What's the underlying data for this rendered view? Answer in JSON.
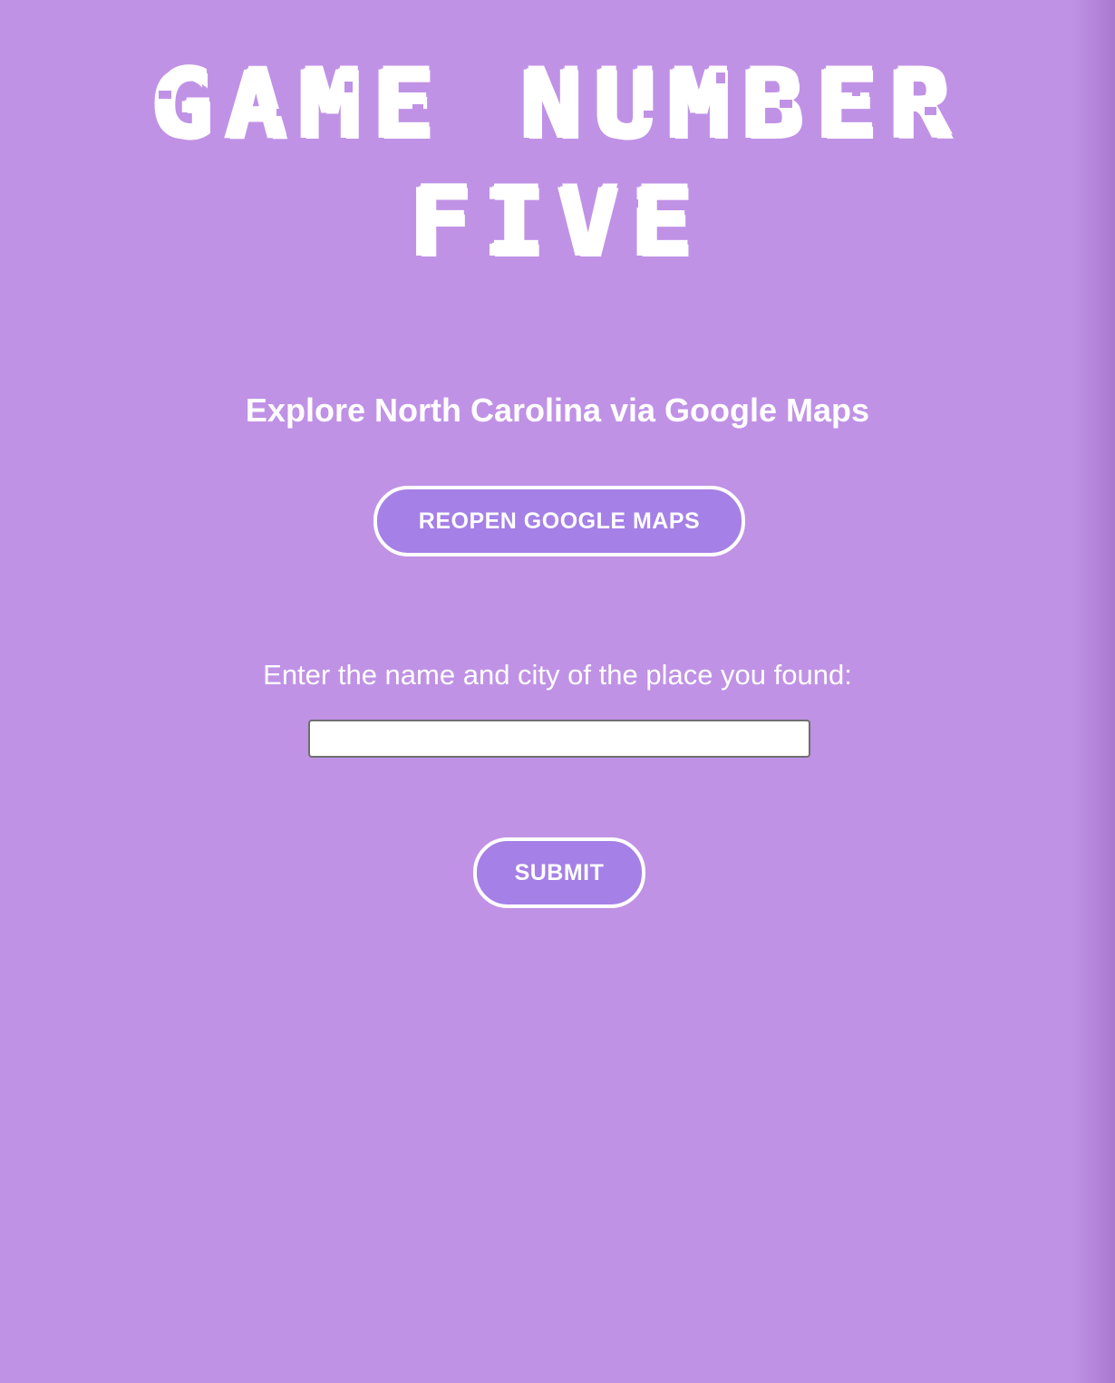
{
  "page": {
    "background_color": "#c092e6",
    "button_color": "#a580e6",
    "text_color": "#ffffff"
  },
  "header": {
    "title_line_1": "GAME NUMBER",
    "title_line_2": "FIVE"
  },
  "main": {
    "subtitle": "Explore North Carolina via Google Maps",
    "reopen_button_label": "REOPEN GOOGLE MAPS",
    "prompt_label": "Enter the name and city of the place you found:",
    "answer_input_value": "",
    "answer_input_placeholder": "",
    "submit_button_label": "SUBMIT"
  }
}
